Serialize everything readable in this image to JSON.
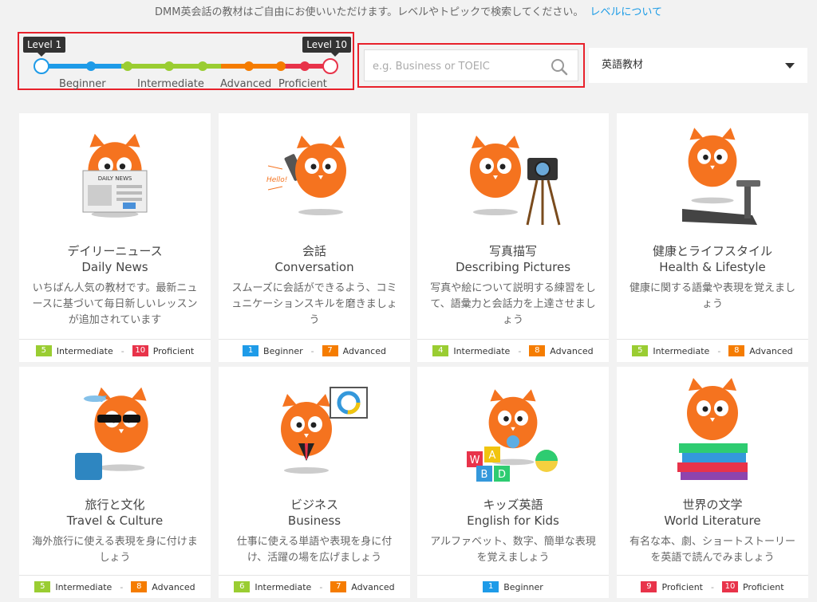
{
  "notice": {
    "text": "DMM英会話の教材はご自由にお使いいただけます。レベルやトピックで検索してください。",
    "link": "レベルについて"
  },
  "level_filter": {
    "min_label": "Level 1",
    "max_label": "Level 10",
    "bands": [
      {
        "name": "Beginner",
        "color": "#1e9be8"
      },
      {
        "name": "Intermediate",
        "color": "#9acd32"
      },
      {
        "name": "Advanced",
        "color": "#f57c00"
      },
      {
        "name": "Proficient",
        "color": "#e8334a"
      }
    ]
  },
  "search": {
    "placeholder": "e.g. Business or TOEIC",
    "value": ""
  },
  "material_select": {
    "selected": "英語教材"
  },
  "colors": {
    "beginner": "#1e9be8",
    "intermediate": "#9acd32",
    "advanced": "#f57c00",
    "proficient": "#e8334a",
    "owl": "#f5731f"
  },
  "cards": [
    {
      "jp": "デイリーニュース",
      "en": "Daily News",
      "desc": "いちばん人気の教材です。最新ニュースに基づいて毎日新しいレッスンが追加されています",
      "from": {
        "num": "5",
        "label": "Intermediate",
        "color": "#9acd32"
      },
      "to": {
        "num": "10",
        "label": "Proficient",
        "color": "#e8334a"
      },
      "icon": "owl-newspaper-icon"
    },
    {
      "jp": "会話",
      "en": "Conversation",
      "desc": "スムーズに会話ができるよう、コミュニケーションスキルを磨きましょう",
      "from": {
        "num": "1",
        "label": "Beginner",
        "color": "#1e9be8"
      },
      "to": {
        "num": "7",
        "label": "Advanced",
        "color": "#f57c00"
      },
      "icon": "owl-phone-icon",
      "hello": "Hello!"
    },
    {
      "jp": "写真描写",
      "en": "Describing Pictures",
      "desc": "写真や絵について説明する練習をして、語彙力と会話力を上達させましょう",
      "from": {
        "num": "4",
        "label": "Intermediate",
        "color": "#9acd32"
      },
      "to": {
        "num": "8",
        "label": "Advanced",
        "color": "#f57c00"
      },
      "icon": "owl-camera-icon"
    },
    {
      "jp": "健康とライフスタイル",
      "en": "Health & Lifestyle",
      "desc": "健康に関する語彙や表現を覚えましょう",
      "from": {
        "num": "5",
        "label": "Intermediate",
        "color": "#9acd32"
      },
      "to": {
        "num": "8",
        "label": "Advanced",
        "color": "#f57c00"
      },
      "icon": "owl-treadmill-icon"
    },
    {
      "jp": "旅行と文化",
      "en": "Travel & Culture",
      "desc": "海外旅行に使える表現を身に付けましょう",
      "from": {
        "num": "5",
        "label": "Intermediate",
        "color": "#9acd32"
      },
      "to": {
        "num": "8",
        "label": "Advanced",
        "color": "#f57c00"
      },
      "icon": "owl-suitcase-icon"
    },
    {
      "jp": "ビジネス",
      "en": "Business",
      "desc": "仕事に使える単語や表現を身に付け、活躍の場を広げましょう",
      "from": {
        "num": "6",
        "label": "Intermediate",
        "color": "#9acd32"
      },
      "to": {
        "num": "7",
        "label": "Advanced",
        "color": "#f57c00"
      },
      "icon": "owl-presentation-icon"
    },
    {
      "jp": "キッズ英語",
      "en": "English for Kids",
      "desc": "アルファベット、数字、簡単な表現を覚えましょう",
      "from": {
        "num": "1",
        "label": "Beginner",
        "color": "#1e9be8"
      },
      "to": null,
      "icon": "owl-baby-icon",
      "blocks": [
        "W",
        "A",
        "B",
        "D"
      ]
    },
    {
      "jp": "世界の文学",
      "en": "World Literature",
      "desc": "有名な本、劇、ショートストーリーを英語で読んでみましょう",
      "from": {
        "num": "9",
        "label": "Proficient",
        "color": "#e8334a"
      },
      "to": {
        "num": "10",
        "label": "Proficient",
        "color": "#e8334a"
      },
      "icon": "owl-books-icon"
    }
  ]
}
